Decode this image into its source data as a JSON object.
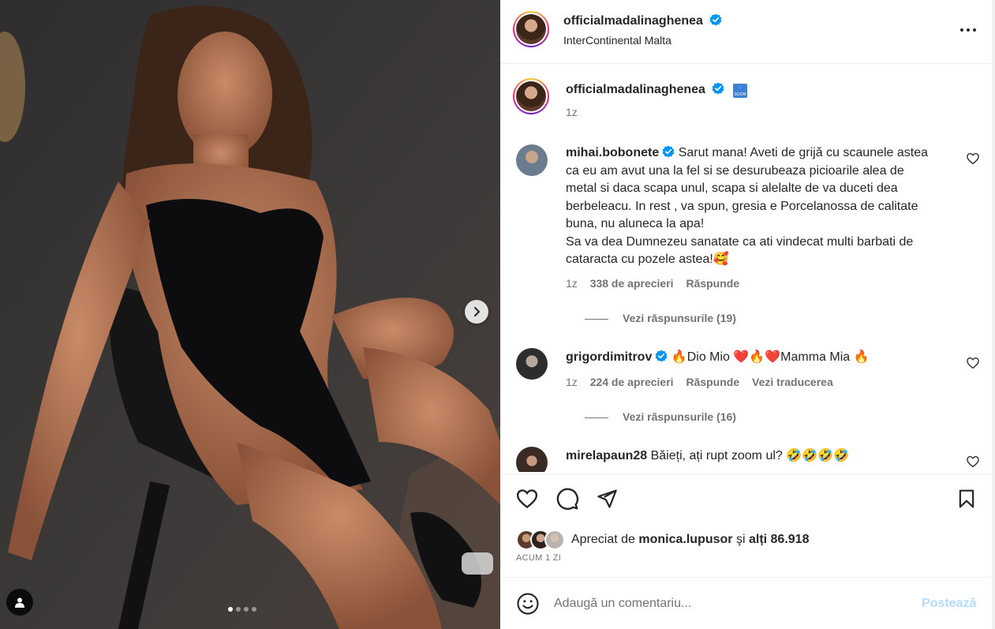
{
  "post": {
    "username": "officialmadalinaghenea",
    "location": "InterContinental Malta",
    "more_icon": "more-horizontal-icon",
    "media": {
      "carousel_count": 4,
      "carousel_active": 1
    }
  },
  "caption": {
    "username": "officialmadalinaghenea",
    "emoji": "soon-arrow-emoji",
    "time": "1z"
  },
  "comments": [
    {
      "username": "mihai.bobonete",
      "verified": true,
      "lines": [
        "Sarut mana! Aveti de grijă cu scaunele astea",
        "ca eu am avut una la fel si se desurubeaza picioarile alea de",
        "metal si daca scapa unul, scapa si alelalte de va duceti dea",
        "berbeleacu. In rest , va spun, gresia e Porcelanossa de calitate",
        "buna, nu aluneca la apa!",
        "Sa va dea Dumnezeu sanatate ca ati vindecat multi barbati de",
        "cataracta cu pozele astea!🥰"
      ],
      "time": "1z",
      "likes": "338 de aprecieri",
      "reply": "Răspunde",
      "replies_label": "Vezi răspunsurile (19)"
    },
    {
      "username": "grigordimitrov",
      "verified": true,
      "text": "🔥Dio Mio ❤️🔥❤️Mamma Mia 🔥",
      "time": "1z",
      "likes": "224 de aprecieri",
      "reply": "Răspunde",
      "translate": "Vezi traducerea",
      "replies_label": "Vezi răspunsurile (16)"
    },
    {
      "username": "mirelapaun28",
      "verified": false,
      "text": "Băieți, ați rupt zoom ul? 🤣🤣🤣🤣"
    }
  ],
  "actions": {
    "like_icon": "heart-outline-icon",
    "comment_icon": "comment-bubble-icon",
    "share_icon": "paper-plane-icon",
    "save_icon": "bookmark-icon"
  },
  "likes": {
    "prefix": "Apreciat de ",
    "user": "monica.lupusor",
    "middle": " şi ",
    "others": "alți 86.918"
  },
  "time_ago": "ACUM 1 ZI",
  "add_comment": {
    "placeholder": "Adaugă un comentariu...",
    "post_label": "Postează",
    "emoji_icon": "smiley-face-icon"
  },
  "colors": {
    "verified": "#0095f6",
    "post_button_disabled": "#b3dbff",
    "secondary_text": "#737373"
  }
}
